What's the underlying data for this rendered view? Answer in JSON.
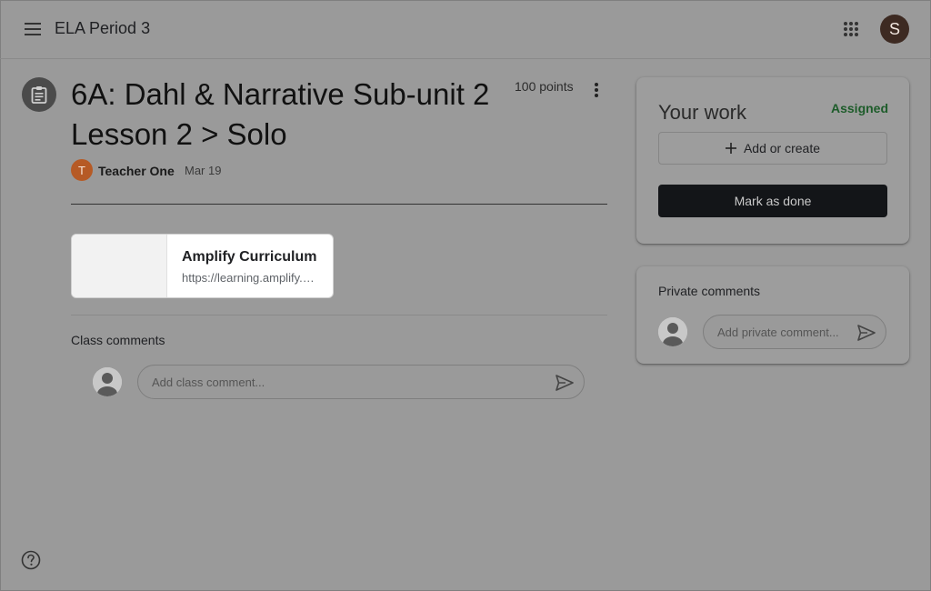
{
  "header": {
    "class_name": "ELA Period 3",
    "account_initial": "S",
    "icons": {
      "menu": "hamburger-menu-icon",
      "apps": "google-apps-grid-icon"
    }
  },
  "assignment": {
    "title": "6A: Dahl & Narrative Sub-unit 2 Lesson 2 > Solo",
    "points": "100 points",
    "teacher_initial": "T",
    "teacher_name": "Teacher One",
    "date": "Mar 19",
    "icon": "assignment-clipboard-icon"
  },
  "attachment": {
    "title": "Amplify Curriculum",
    "url": "https://learning.amplify.com"
  },
  "class_comments": {
    "label": "Class comments",
    "placeholder": "Add class comment..."
  },
  "your_work": {
    "heading": "Your work",
    "status": "Assigned",
    "add_label": "Add or create",
    "mark_done_label": "Mark as done"
  },
  "private_comments": {
    "label": "Private comments",
    "placeholder": "Add private comment..."
  },
  "colors": {
    "status_green": "#1d5c2a",
    "teacher_avatar": "#b65a25",
    "account_avatar": "#3d2a22",
    "primary_button": "#131518"
  }
}
